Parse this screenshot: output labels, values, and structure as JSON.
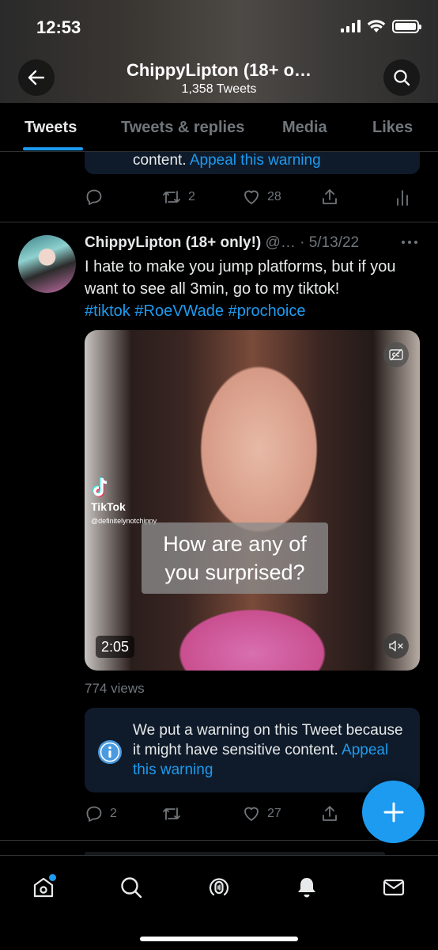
{
  "status_bar": {
    "time": "12:53"
  },
  "header": {
    "profile_name": "ChippyLipton (18+ o…",
    "tweet_count": "1,358 Tweets"
  },
  "tabs": [
    {
      "label": "Tweets",
      "active": true
    },
    {
      "label": "Tweets & replies",
      "active": false
    },
    {
      "label": "Media",
      "active": false
    },
    {
      "label": "Likes",
      "active": false
    }
  ],
  "previous_tweet": {
    "warning_tail": "content.",
    "appeal_link": "Appeal this warning",
    "retweets": "2",
    "likes": "28"
  },
  "tweet": {
    "display_name": "ChippyLipton (18+ only!)",
    "handle": "@…",
    "date": "· 5/13/22",
    "text": "I hate to make you jump platforms, but if you want to see all 3min, go to my tiktok!",
    "hashtags": [
      "#tiktok",
      "#RoeVWade",
      "#prochoice"
    ],
    "media": {
      "watermark_name": "TikTok",
      "watermark_handle": "@definitelynotchippy",
      "caption_line1": "How are any of",
      "caption_line2": "you surprised?",
      "duration": "2:05"
    },
    "views": "774 views",
    "warning_text": "We put a warning on this Tweet because it might have sensitive content.",
    "appeal_link": "Appeal this warning",
    "replies": "2",
    "likes": "27"
  },
  "colors": {
    "accent": "#1d9bf0",
    "warning_bg": "#0f1b2a",
    "muted": "#71767b"
  },
  "icons": {
    "header": [
      "back-arrow-icon",
      "search-icon"
    ],
    "actions": [
      "reply-icon",
      "retweet-icon",
      "like-icon",
      "share-icon",
      "analytics-icon"
    ],
    "bottom_nav": [
      "home-icon",
      "explore-icon",
      "spaces-icon",
      "notifications-icon",
      "messages-icon"
    ]
  }
}
